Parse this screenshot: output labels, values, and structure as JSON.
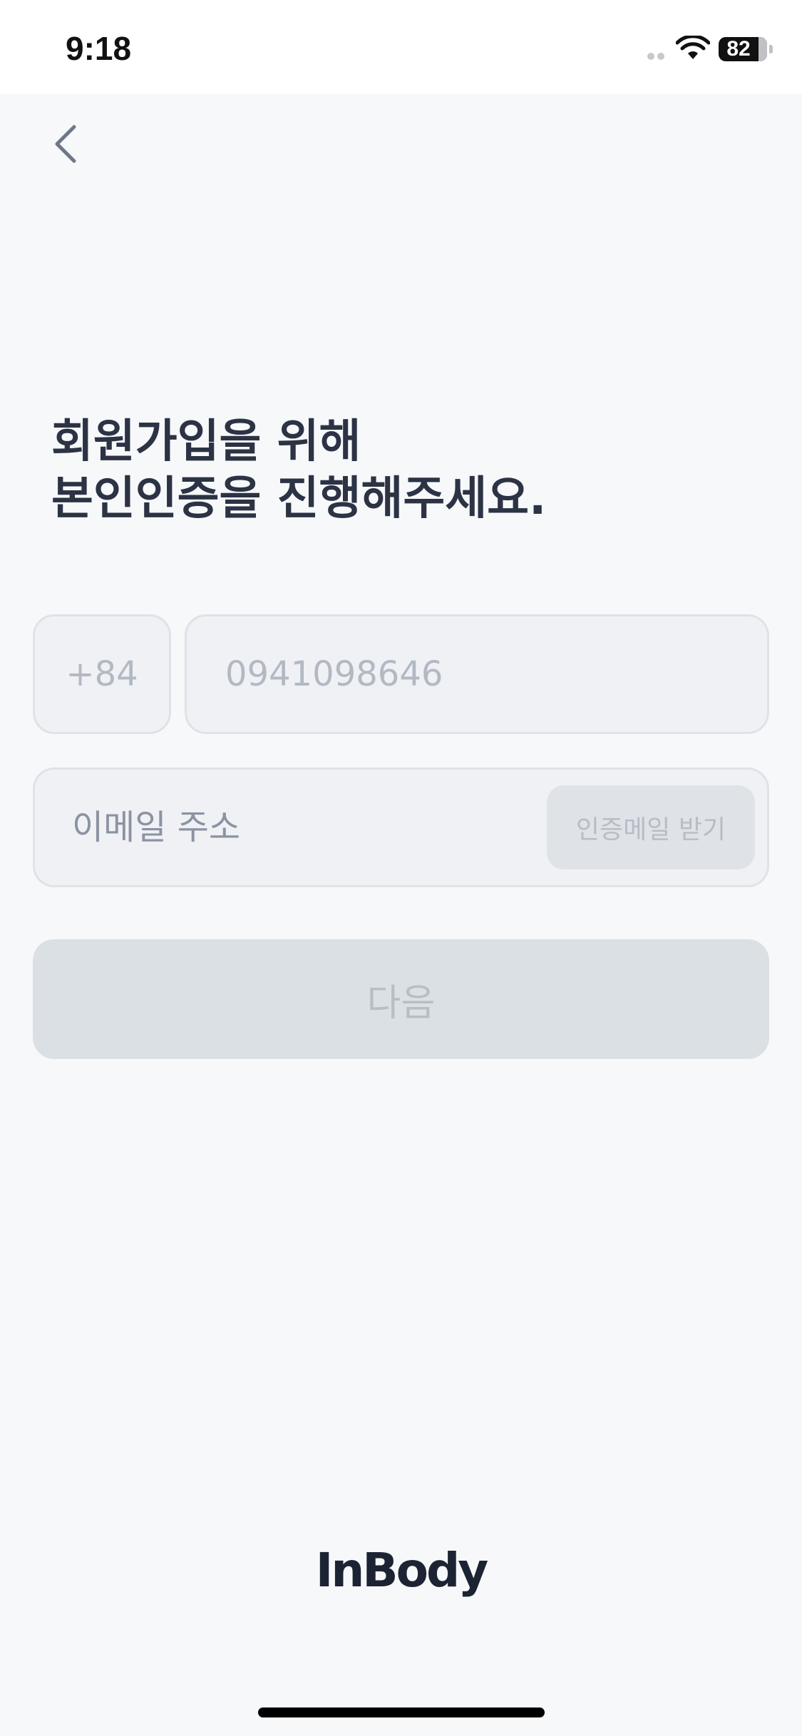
{
  "status_bar": {
    "time": "9:18",
    "battery_level": "82",
    "icons": [
      "cellular-signal-icon",
      "wifi-icon",
      "battery-icon"
    ]
  },
  "navigation": {
    "back_icon": "chevron-left-icon"
  },
  "headline": {
    "line1": "회원가입을 위해",
    "line2": "본인인증을 진행해주세요."
  },
  "phone": {
    "country_code": "+84",
    "number_placeholder": "0941098646"
  },
  "email": {
    "placeholder": "이메일 주소",
    "verify_button_label": "인증메일 받기"
  },
  "next_button_label": "다음",
  "brand": {
    "logo_text": "InBody"
  },
  "colors": {
    "background": "#f7f8fa",
    "headline": "#2b3344",
    "field_background": "#eff1f5",
    "field_border": "#dfe2e7",
    "disabled_button": "#dbe0e4",
    "disabled_text": "#b8bec7",
    "logo": "#1c2433"
  }
}
